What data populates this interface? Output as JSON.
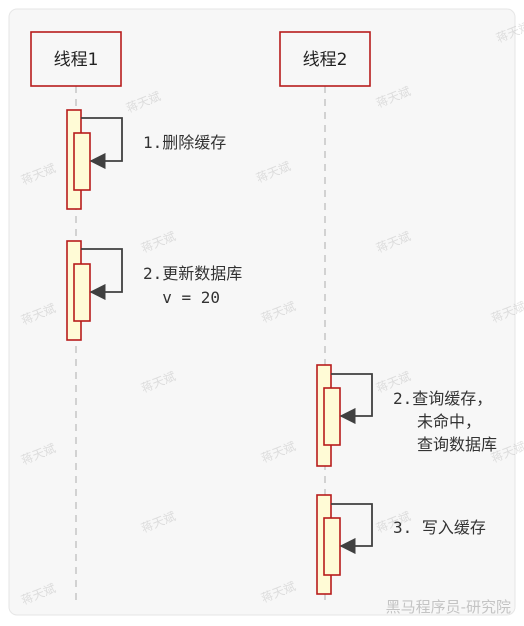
{
  "diagram": {
    "colors": {
      "panel_bg": "#f7f7f7",
      "participant_border": "#b71c1c",
      "participant_fill": "#f7f7f7",
      "activation_border": "#b71c1c",
      "activation_fill": "#fffbd6",
      "lifeline": "#b9b9b9",
      "arrow": "#404040",
      "text": "#333333"
    },
    "participants": [
      {
        "id": "p1",
        "label": "线程1"
      },
      {
        "id": "p2",
        "label": "线程2"
      }
    ],
    "messages": [
      {
        "id": "m1",
        "participant": "p1",
        "lines": [
          "1.删除缓存"
        ]
      },
      {
        "id": "m2",
        "participant": "p1",
        "lines": [
          "2.更新数据库",
          "  v = 20"
        ]
      },
      {
        "id": "m3",
        "participant": "p2",
        "lines": [
          "2.查询缓存，",
          "未命中，",
          "查询数据库"
        ]
      },
      {
        "id": "m4",
        "participant": "p2",
        "lines": [
          "3. 写入缓存"
        ]
      }
    ],
    "watermark": "蒋天斌",
    "footer": "黑马程序员-研究院"
  }
}
